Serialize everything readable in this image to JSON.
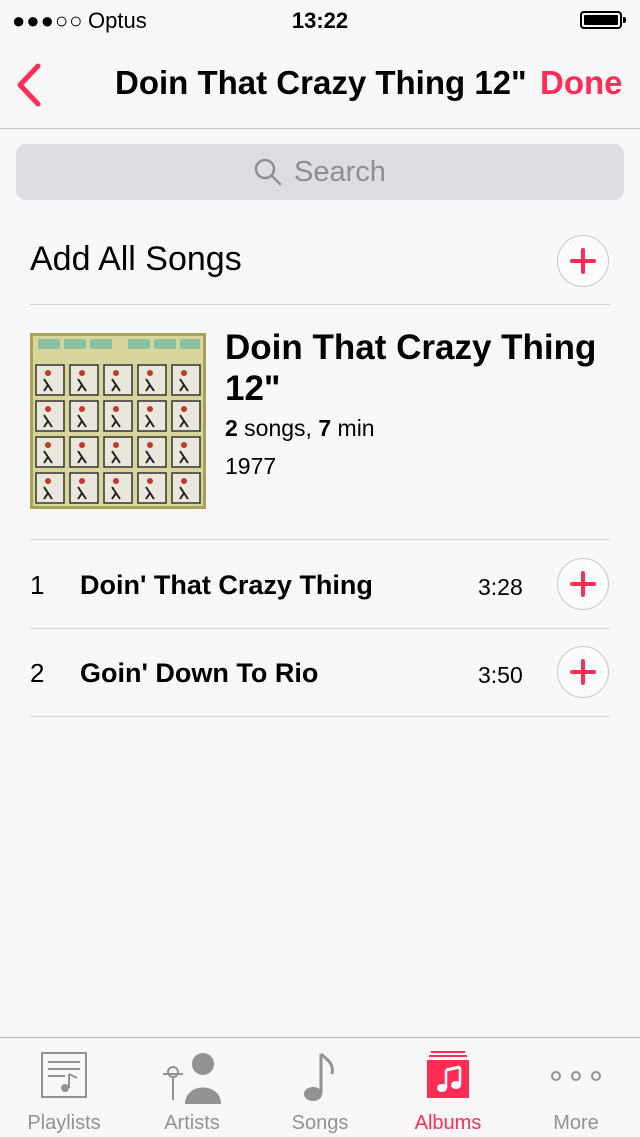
{
  "status_bar": {
    "signal": "●●●○○",
    "carrier": "Optus",
    "time": "13:22"
  },
  "nav": {
    "title": "Doin That Crazy Thing 12\"",
    "done_label": "Done",
    "accent_color": "#ff2d55"
  },
  "search": {
    "placeholder": "Search"
  },
  "add_all": {
    "label": "Add All Songs"
  },
  "album": {
    "title": "Doin That Crazy Thing 12\"",
    "song_count": "2",
    "songs_word": " songs, ",
    "duration_min": "7",
    "min_word": " min",
    "year": "1977"
  },
  "tracks": [
    {
      "number": "1",
      "title": "Doin' That Crazy Thing",
      "duration": "3:28"
    },
    {
      "number": "2",
      "title": "Goin' Down To Rio",
      "duration": "3:50"
    }
  ],
  "tabs": [
    {
      "label": "Playlists",
      "icon": "playlists-icon",
      "active": false
    },
    {
      "label": "Artists",
      "icon": "artists-icon",
      "active": false
    },
    {
      "label": "Songs",
      "icon": "songs-icon",
      "active": false
    },
    {
      "label": "Albums",
      "icon": "albums-icon",
      "active": true
    },
    {
      "label": "More",
      "icon": "more-icon",
      "active": false
    }
  ]
}
